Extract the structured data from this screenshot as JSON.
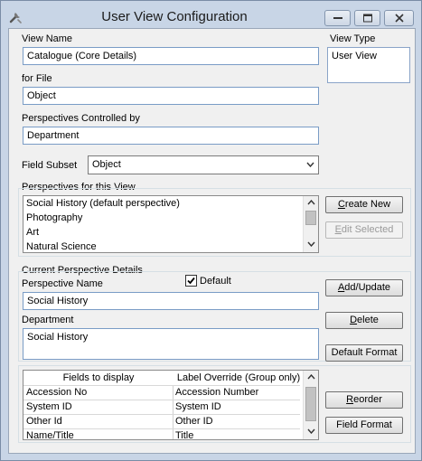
{
  "window": {
    "title": "User View Configuration",
    "icon": "tools-icon",
    "buttons": [
      "minimize-icon",
      "restore-icon",
      "close-icon"
    ]
  },
  "view_name": {
    "label": "View Name",
    "value": "Catalogue (Core Details)"
  },
  "for_file": {
    "label": "for File",
    "value": "Object"
  },
  "perspectives_controlled_by": {
    "label": "Perspectives Controlled by",
    "value": "Department"
  },
  "view_type": {
    "label": "View Type",
    "value": "User View"
  },
  "field_subset": {
    "label": "Field Subset",
    "value": "Object"
  },
  "perspectives": {
    "group_label": "Perspectives for this View",
    "items": [
      "Social History (default perspective)",
      "Photography",
      "Art",
      "Natural Science"
    ],
    "create_new_label": "Create New",
    "create_new_accel": "C",
    "create_new_rest": "reate New",
    "edit_selected_accel": "E",
    "edit_selected_rest": "dit Selected"
  },
  "current": {
    "group_label": "Current Perspective Details",
    "perspective_name_label": "Perspective Name",
    "default_label": "Default",
    "default_checked": true,
    "perspective_name": "Social History",
    "department_label": "Department",
    "department": "Social History",
    "add_update_accel": "A",
    "add_update_rest": "dd/Update",
    "delete_accel": "D",
    "delete_rest": "elete",
    "default_format_label": "Default Format"
  },
  "fields": {
    "columns": [
      "Fields to display",
      "Label Override (Group only)"
    ],
    "rows": [
      [
        "Accession No",
        "Accession Number"
      ],
      [
        "System ID",
        "System ID"
      ],
      [
        "Other Id",
        "Other ID"
      ],
      [
        "Name/Title",
        "Title"
      ]
    ],
    "reorder_accel": "R",
    "reorder_rest": "eorder",
    "field_format_label": "Field Format"
  }
}
